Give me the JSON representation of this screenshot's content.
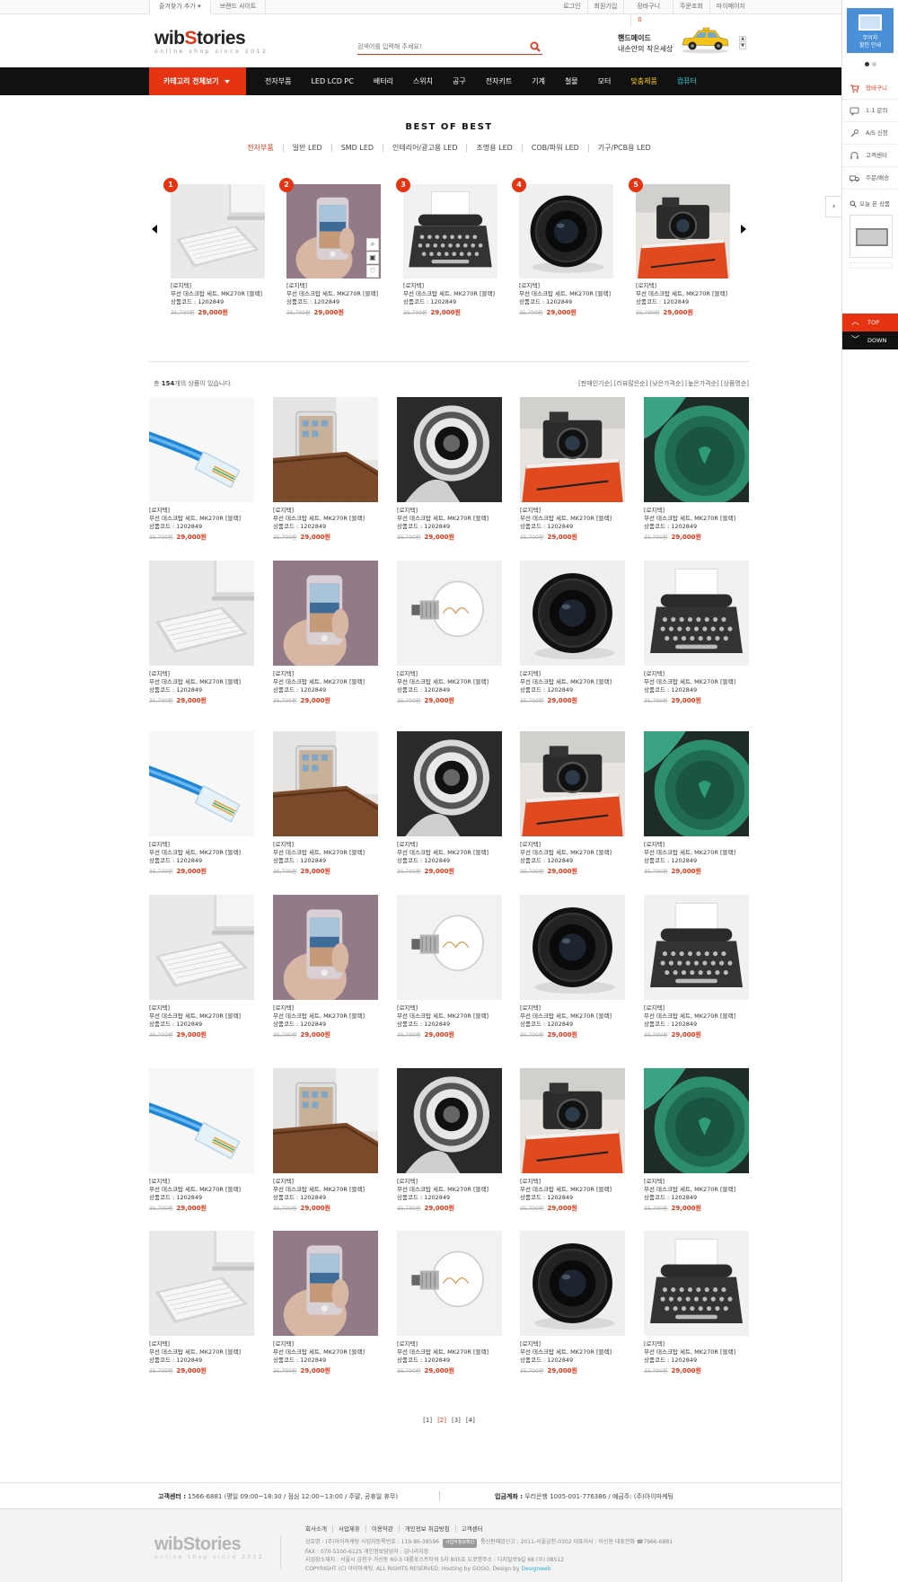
{
  "util": {
    "left": [
      "즐겨찾기 추가 ▾",
      "브랜드 사이트"
    ],
    "right": [
      "로그인",
      "회원가입",
      "장바구니",
      "주문조회",
      "마이페이지"
    ],
    "cart_count": "0"
  },
  "header": {
    "logo_main": "wib",
    "logo_s": "S",
    "logo_rest": "tories",
    "logo_sub": "online shop since 2012",
    "search_placeholder": "검색어를 입력해 주세요!",
    "banner_line1": "핸드메이드",
    "banner_line2": "내손안의 작은세상"
  },
  "nav": {
    "category_button": "카테고리 전체보기",
    "items": [
      "전자부품",
      "LED LCD PC",
      "배터리",
      "스위치",
      "공구",
      "전자키트",
      "기계",
      "철물",
      "모터",
      "맞춤제품",
      "컴퓨터"
    ]
  },
  "best": {
    "title": "BEST OF BEST",
    "tabs": [
      "전자부품",
      "일반 LED",
      "SMD LED",
      "인테리어/광고용 LED",
      "조명용 LED",
      "COB/파워 LED",
      "기구/PCB용 LED"
    ],
    "items": [
      {
        "rank": "1",
        "image": "keyboard"
      },
      {
        "rank": "2",
        "image": "phone"
      },
      {
        "rank": "3",
        "image": "typewriter"
      },
      {
        "rank": "4",
        "image": "lens"
      },
      {
        "rank": "5",
        "image": "camera"
      }
    ]
  },
  "product_text": {
    "brand": "[로지텍]",
    "name": "무선 데스크탑 세트, MK270R [블랙]",
    "code": "상품코드 : 1202849",
    "old_price": "35,700원",
    "new_price": "29,000원"
  },
  "list": {
    "total_prefix": "총 ",
    "total_count": "154",
    "total_suffix": "개의 상품이 있습니다.",
    "sort": [
      "[판매인기순]",
      "[리뷰많은순]",
      "[낮은가격순]",
      "[높은가격순]",
      "[상품명순]"
    ],
    "rows": [
      [
        "cable",
        "tablet",
        "dial",
        "camera",
        "headphone"
      ],
      [
        "keyboard",
        "phone",
        "bulb",
        "lens",
        "typewriter"
      ],
      [
        "cable",
        "tablet",
        "dial",
        "camera",
        "headphone"
      ],
      [
        "keyboard",
        "phone",
        "bulb",
        "lens",
        "typewriter"
      ],
      [
        "cable",
        "tablet",
        "dial",
        "camera",
        "headphone"
      ],
      [
        "keyboard",
        "phone",
        "bulb",
        "lens",
        "typewriter"
      ]
    ]
  },
  "paging": [
    "[1]",
    "[2]",
    "[3]",
    "[4]"
  ],
  "paging_active": 1,
  "footer": {
    "cs_label": "고객센터 :",
    "cs_text": "1566-6881 (평일 09:00~18:30 / 점심 12:00~13:00 / 주말, 공휴일 휴무)",
    "bank_label": "입금계좌 :",
    "bank_text": "우리은행 1005-001-776386 / 예금주: (주)아이마케팅",
    "links": [
      "회사소개",
      "사업제휴",
      "이용약관",
      "개인정보 취급방침",
      "고객센터"
    ],
    "addr1": "상호명 : (주)아이마케팅   사업자등록번호 : 119-86-38596",
    "addr1_tag": "사업자정보확인",
    "addr1_rest": "통신판매업신고 : 2011-서울금천-0302   대표이사 : 이신현   대표전화 ☎7966-6881",
    "addr2": "FAX : 070-5100-6125   개인정보담당자 : 김나라차장",
    "addr3": "사업장소재지 : 서울시 금천구 가산동 60-3 대륭포스트타워 5차 805호   도로명주소 : 디지털로9길 68 (우) 08512",
    "copy_prefix": "COPYRIGHT (C) 아이마케팅. ALL RIGHTS RESERVED. Hosting by GOGO, Design by ",
    "copy_designer": "Designweb"
  },
  "quick": {
    "coupon": "무이자\n할인 안내",
    "menu": [
      "장바구니",
      "1:1 문의",
      "A/S 신청",
      "고객센터",
      "주문/배송"
    ],
    "recent_label": "오늘 본 상품",
    "top": "TOP",
    "down": "DOWN"
  },
  "colors": {
    "accent": "#e63312",
    "nav_bg": "#111111",
    "coupon_bg": "#4a90d9"
  }
}
